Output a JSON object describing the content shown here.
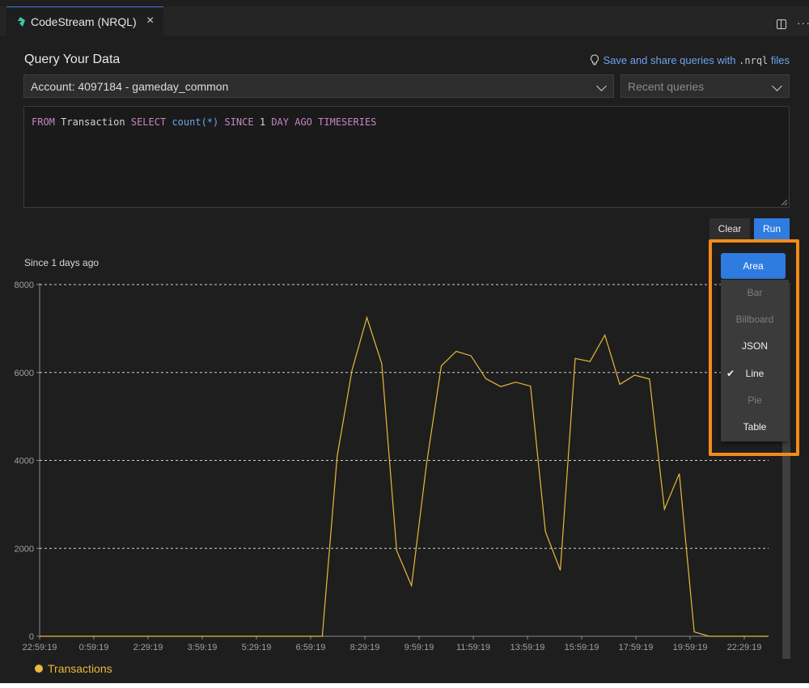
{
  "tab": {
    "title": "CodeStream (NRQL)",
    "close": "×"
  },
  "header": {
    "title": "Query Your Data",
    "hint_text": "Save and share queries with ",
    "hint_ext": ".nrql",
    "hint_suffix": " files"
  },
  "account_select": {
    "value": "Account: 4097184 - gameday_common"
  },
  "recent_select": {
    "placeholder": "Recent queries"
  },
  "query": {
    "tokens": [
      "FROM",
      "Transaction",
      "SELECT",
      "count(*)",
      "SINCE",
      "1",
      "DAY",
      "AGO",
      "TIMESERIES"
    ]
  },
  "buttons": {
    "clear": "Clear",
    "run": "Run"
  },
  "results": {
    "since": "Since 1 days ago"
  },
  "chart_type_menu": {
    "current": "Area",
    "items": [
      {
        "label": "Bar",
        "enabled": false
      },
      {
        "label": "Billboard",
        "enabled": false
      },
      {
        "label": "JSON",
        "enabled": true
      },
      {
        "label": "Line",
        "enabled": true,
        "checked": true
      },
      {
        "label": "Pie",
        "enabled": false
      },
      {
        "label": "Table",
        "enabled": true
      }
    ],
    "check_mark": "✔"
  },
  "colors": {
    "series": "#e9b93c",
    "accent": "#2f7ce0",
    "highlight": "#f28c18",
    "background": "#1e1e1e"
  },
  "chart_data": {
    "type": "line",
    "title": "",
    "xlabel": "",
    "ylabel": "",
    "ylim": [
      0,
      8000
    ],
    "yticks": [
      0,
      2000,
      4000,
      6000,
      8000
    ],
    "xtick_labels": [
      "22:59:19",
      "0:59:19",
      "2:29:19",
      "3:59:19",
      "5:29:19",
      "6:59:19",
      "8:29:19",
      "9:59:19",
      "11:59:19",
      "13:59:19",
      "15:59:19",
      "17:59:19",
      "19:59:19",
      "22:29:19"
    ],
    "grid": "horizontal dashed",
    "legend_position": "bottom-left",
    "series": [
      {
        "name": "Transactions",
        "values": [
          0,
          0,
          0,
          0,
          0,
          0,
          0,
          0,
          0,
          0,
          0,
          0,
          0,
          0,
          0,
          0,
          0,
          0,
          0,
          0,
          4100,
          6050,
          7250,
          6200,
          1950,
          1150,
          3900,
          6150,
          6480,
          6380,
          5860,
          5680,
          5780,
          5690,
          2380,
          1500,
          6320,
          6250,
          6850,
          5730,
          5940,
          5850,
          2890,
          3700,
          100,
          0,
          0,
          0,
          0,
          0
        ]
      }
    ]
  }
}
